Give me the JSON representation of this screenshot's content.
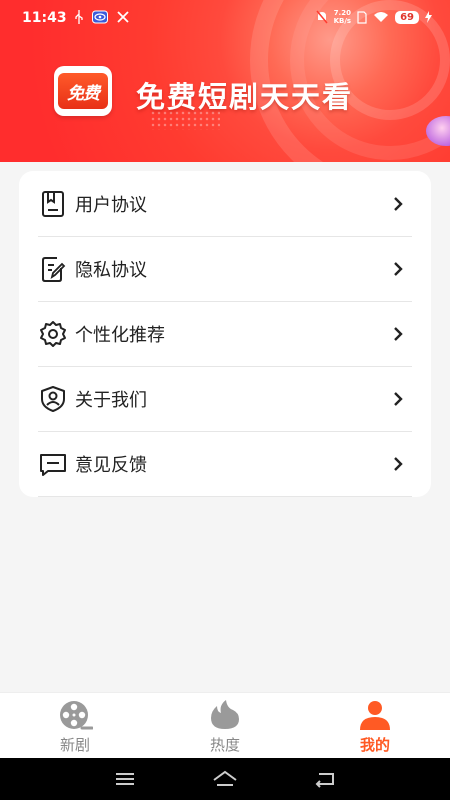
{
  "status_bar": {
    "time": "11:43",
    "net_speed_value": "7.20",
    "net_speed_unit": "KB/s",
    "battery": "69"
  },
  "banner": {
    "logo_text": "免费",
    "slogan": "免费短剧天天看"
  },
  "menu": {
    "items": [
      {
        "label": "用户协议",
        "icon": "document-icon"
      },
      {
        "label": "隐私协议",
        "icon": "edit-document-icon"
      },
      {
        "label": "个性化推荐",
        "icon": "gear-icon"
      },
      {
        "label": "关于我们",
        "icon": "user-shield-icon"
      },
      {
        "label": "意见反馈",
        "icon": "message-icon"
      }
    ]
  },
  "tabs": {
    "items": [
      {
        "label": "新剧",
        "icon": "film-reel-icon"
      },
      {
        "label": "热度",
        "icon": "flame-icon"
      },
      {
        "label": "我的",
        "icon": "person-icon"
      }
    ],
    "active": "我的"
  },
  "colors": {
    "accent": "#ff5a24",
    "banner_red": "#ff3b30",
    "inactive": "#888888"
  }
}
